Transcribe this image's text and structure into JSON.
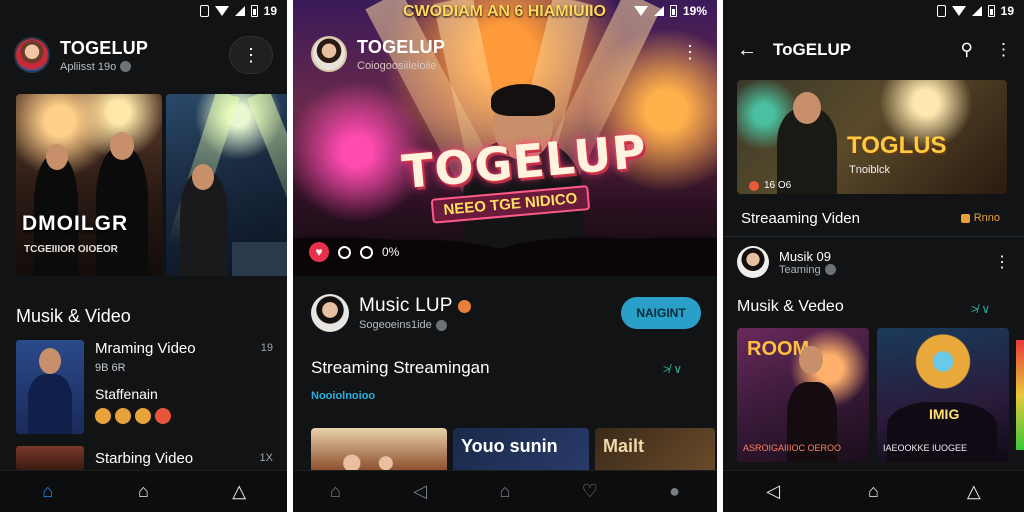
{
  "phones": [
    {
      "status_icons": [
        "nfc-icon",
        "wifi-icon",
        "cell-signal-icon",
        "battery-icon"
      ],
      "status_text": "19",
      "channel": {
        "title": "TOGELUP",
        "subtitle": "Apliisst 19o"
      },
      "banner": {
        "title": "DMOILGR",
        "subtitle": "TCGEIIIOR OIOEOR"
      },
      "section_title": "Musik & Video",
      "items": [
        {
          "title": "Mraming Video",
          "subtitle": "9B 6R",
          "title2": "Staffenain",
          "more": "19"
        },
        {
          "title": "Starbing Video",
          "more": "1X"
        }
      ],
      "nav": [
        "home-icon",
        "home-outline-icon",
        "share-icon"
      ]
    },
    {
      "status_text": "19%",
      "hero_top_text": "CWODIAM AN 6 HIAMIUIIO",
      "channel": {
        "title": "TOGELUP",
        "subtitle": "Coiogoosiileioile"
      },
      "hero_logo": {
        "main": "TOGELUP",
        "sub": "NEEO TGE NIDICO"
      },
      "hero_count": "0%",
      "sub_channel": {
        "title": "Music LUP",
        "subtitle": "Sogeoeins1ide",
        "button": "NAIGINT"
      },
      "section_title": "Streaming Streamingan",
      "section_link": "Nooiolnoioo",
      "see_all": "≯ ∨",
      "cards": [
        "",
        "Youo sunin",
        "Mailt"
      ],
      "nav": [
        "home-icon",
        "back-icon",
        "home-outline-icon",
        "heart-icon",
        "profile-icon"
      ]
    },
    {
      "status_text": "19",
      "title": "ToGELUP",
      "banner": {
        "title": "TOGLUS",
        "subtitle": "Tnoiblck",
        "meta": "16 O6"
      },
      "stream_title": "Streaaming Viden",
      "badge": "Rnno",
      "channel": {
        "title": "Musik  09",
        "subtitle": "Teaming"
      },
      "section_title": "Musik & Vedeo",
      "see_all": "≯ ∨",
      "cards": [
        {
          "title": "ROOM",
          "subtitle": "ASROIGAIIIOC OEROO"
        },
        {
          "title": "IMIG",
          "subtitle": "IAEOOKKE IUOGEE"
        }
      ],
      "nav": [
        "back-icon",
        "home-outline-icon",
        "share-icon"
      ]
    }
  ],
  "colors": {
    "background": "#121314",
    "accent_blue": "#2a8aff",
    "subscribe": "#2aa0c8",
    "link": "#2ab0e0",
    "logo_yellow": "#ffca40"
  }
}
